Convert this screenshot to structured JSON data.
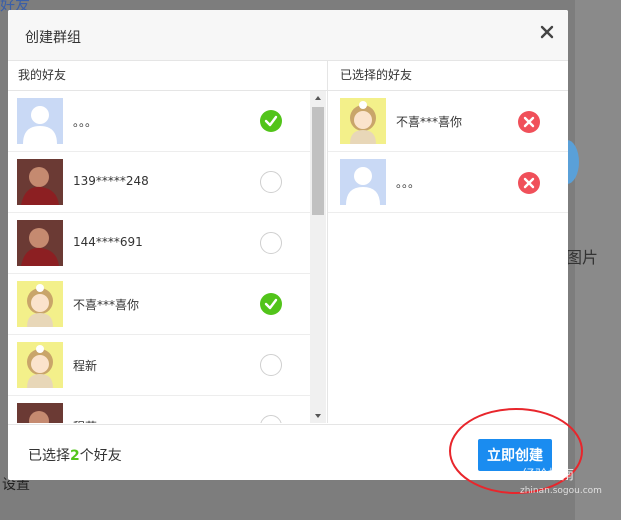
{
  "background": {
    "top_left_text": "好友",
    "right_text": "图片",
    "bottom_left_text": "设置"
  },
  "dialog": {
    "title": "创建群组",
    "left_header": "我的好友",
    "right_header": "已选择的好友",
    "friends": [
      {
        "name": "。。。",
        "selected": true,
        "avatar": "default-avatar"
      },
      {
        "name": "139*****248",
        "selected": false,
        "avatar": "photo-avatar"
      },
      {
        "name": "144****691",
        "selected": false,
        "avatar": "photo-avatar"
      },
      {
        "name": "不喜***喜你",
        "selected": true,
        "avatar": "anime-avatar"
      },
      {
        "name": "程新",
        "selected": false,
        "avatar": "anime-avatar"
      },
      {
        "name": "程荣",
        "selected": false,
        "avatar": "photo-avatar"
      }
    ],
    "selected_friends": [
      {
        "name": "不喜***喜你",
        "avatar": "anime-avatar"
      },
      {
        "name": "。。。",
        "avatar": "default-avatar"
      }
    ],
    "footer": {
      "count_prefix": "已选择",
      "count": "2",
      "count_suffix": "个好友",
      "create_label": "立即创建"
    }
  },
  "watermark": {
    "text": "经验指南",
    "sub": "zhinan.sogou.com"
  },
  "colors": {
    "accent": "#1a8cf0",
    "check_green": "#52c41a",
    "remove_red": "#f0505a"
  }
}
